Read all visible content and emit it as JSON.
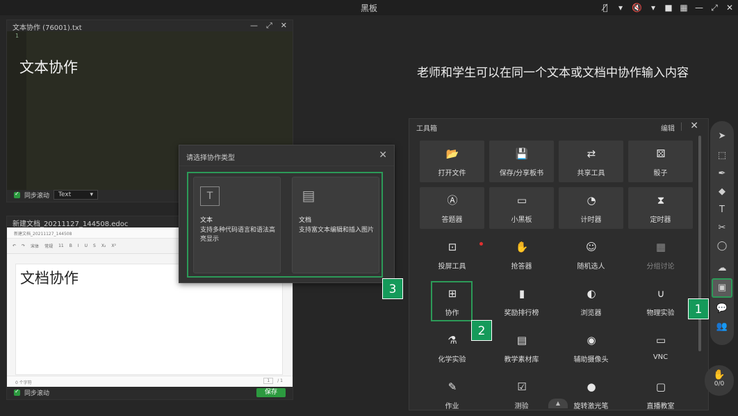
{
  "app": {
    "title": "黑板"
  },
  "topbar": {
    "icons": [
      "mic-off-icon",
      "chevron-down-icon",
      "speaker-off-icon",
      "chevron-down-icon",
      "camera-icon",
      "grid-icon",
      "minimize-icon",
      "maximize-icon",
      "close-icon"
    ]
  },
  "headline": "老师和学生可以在同一个文本或文档中协作输入内容",
  "text_window": {
    "title": "文本协作 (76001).txt",
    "line_number": "1",
    "content": "文本协作",
    "sync_label": "同步滚动",
    "mode_value": "Text"
  },
  "doc_window": {
    "title": "新建文档_20211127_144508.edoc",
    "inner_title": "新建文档_20211127_144508",
    "toolbar_items": [
      "宋体",
      "常规",
      "11",
      "B",
      "I",
      "U",
      "S",
      "X₂",
      "X²"
    ],
    "content": "文档协作",
    "word_count": "0 个字符",
    "page_current": "1",
    "page_total": "/ 1",
    "sync_label": "同步滚动",
    "save_label": "保存"
  },
  "dialog": {
    "title": "请选择协作类型",
    "options": [
      {
        "name": "文本",
        "desc": "支持多种代码语言和语法高亮显示",
        "icon": "text-type-icon"
      },
      {
        "name": "文档",
        "desc": "支持富文本编辑和插入图片",
        "icon": "document-icon"
      }
    ]
  },
  "toolbox": {
    "title": "工具箱",
    "edit_label": "编辑",
    "tiles": [
      {
        "label": "打开文件",
        "icon": "folder-icon"
      },
      {
        "label": "保存/分享板书",
        "icon": "save-icon"
      },
      {
        "label": "共享工具",
        "icon": "share-icon"
      },
      {
        "label": "骰子",
        "icon": "dice-icon"
      },
      {
        "label": "答题器",
        "icon": "answer-icon"
      },
      {
        "label": "小黑板",
        "icon": "blackboard-icon"
      },
      {
        "label": "计时器",
        "icon": "timer-icon"
      },
      {
        "label": "定时器",
        "icon": "hourglass-icon"
      },
      {
        "label": "投屏工具",
        "icon": "cast-icon"
      },
      {
        "label": "抢答器",
        "icon": "buzzer-icon"
      },
      {
        "label": "随机选人",
        "icon": "random-person-icon"
      },
      {
        "label": "分组讨论",
        "icon": "group-icon"
      },
      {
        "label": "协作",
        "icon": "collab-icon"
      },
      {
        "label": "奖励排行榜",
        "icon": "ranking-icon"
      },
      {
        "label": "浏览器",
        "icon": "browser-icon"
      },
      {
        "label": "物理实验",
        "icon": "magnet-icon"
      },
      {
        "label": "化学实验",
        "icon": "flask-icon"
      },
      {
        "label": "教学素材库",
        "icon": "library-icon"
      },
      {
        "label": "辅助摄像头",
        "icon": "webcam-icon"
      },
      {
        "label": "VNC",
        "icon": "vnc-icon"
      },
      {
        "label": "作业",
        "icon": "homework-icon"
      },
      {
        "label": "测验",
        "icon": "quiz-icon"
      },
      {
        "label": "旋转激光笔",
        "icon": "laser-icon"
      },
      {
        "label": "直播教室",
        "icon": "live-icon"
      }
    ]
  },
  "rail": {
    "icons": [
      "pointer-icon",
      "select-icon",
      "pen-icon",
      "eraser-icon",
      "text-icon",
      "scissors-icon",
      "shape-icon",
      "cloud-icon",
      "toolbox-icon",
      "chat-icon",
      "users-icon"
    ]
  },
  "counter": {
    "value": "0/0"
  },
  "badges": [
    "1",
    "2",
    "3"
  ],
  "colors": {
    "accent": "#2c9a58",
    "save_button": "#2c9a3f",
    "background": "#262626"
  }
}
